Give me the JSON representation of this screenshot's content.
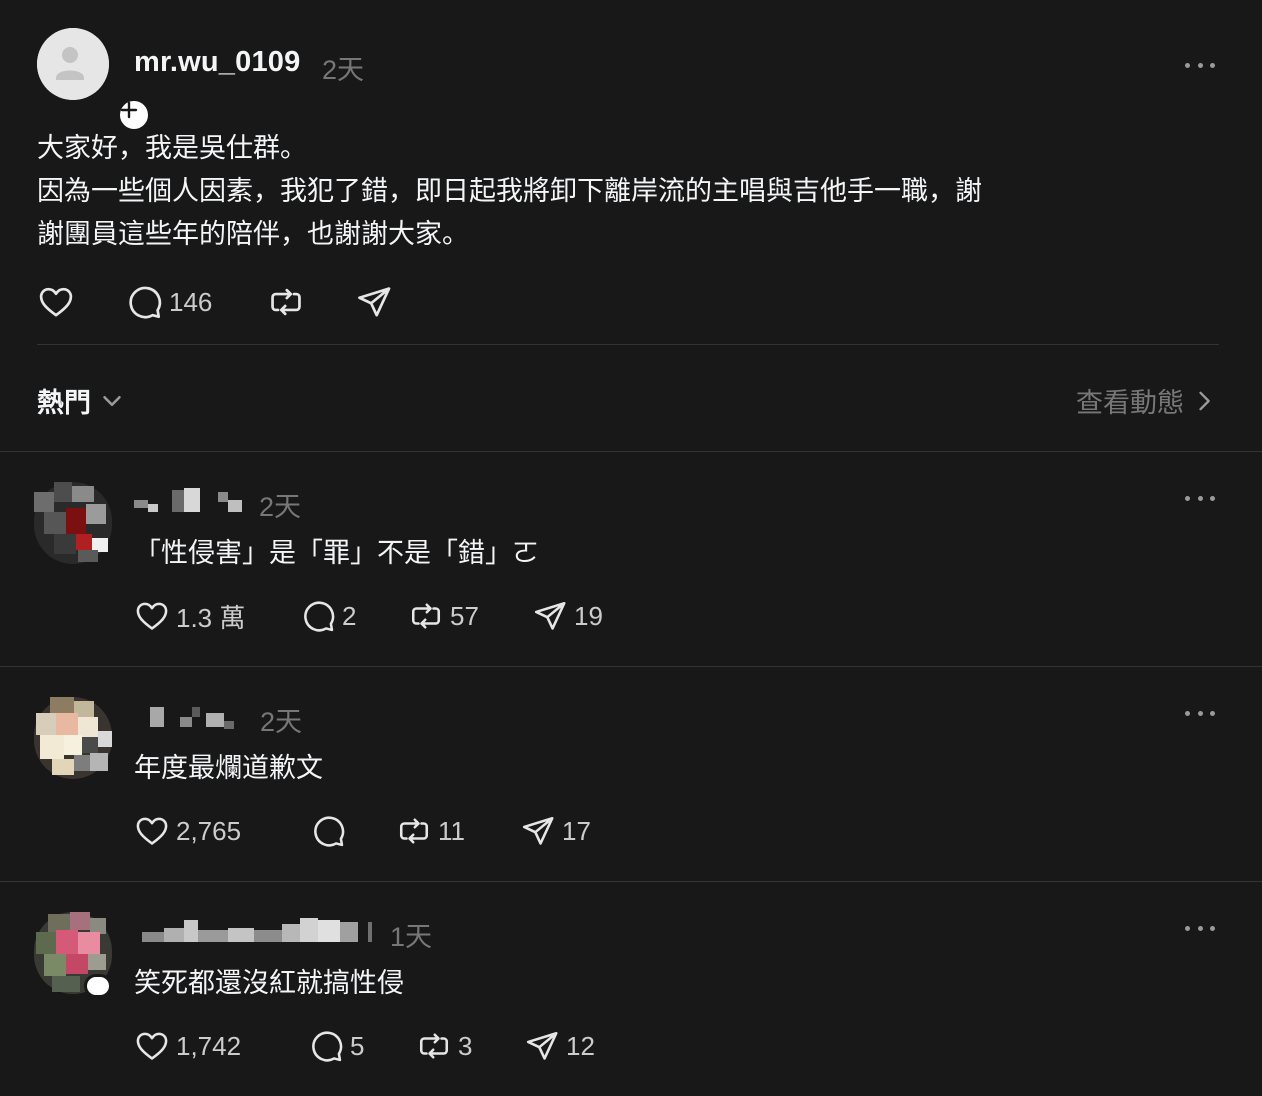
{
  "post": {
    "username": "mr.wu_0109",
    "time": "2天",
    "body_lines": [
      "大家好，我是吳仕群。",
      "因為一些個人因素，我犯了錯，即日起我將卸下離岸流的主唱與吉他手一職，謝",
      "謝團員這些年的陪伴，也謝謝大家。"
    ],
    "replies_count": "146",
    "icons": {
      "like": "heart-icon",
      "reply": "comment-icon",
      "repost": "repost-icon",
      "share": "send-icon",
      "more": "more-horizontal-icon",
      "follow": "plus-icon"
    }
  },
  "sort": {
    "label": "熱門",
    "view_activity": "查看動態"
  },
  "replies": [
    {
      "time": "2天",
      "text": "「性侵害」是「罪」不是「錯」ㄛ",
      "likes": "1.3 萬",
      "comments": "2",
      "reposts": "57",
      "shares": "19"
    },
    {
      "time": "2天",
      "text": "年度最爛道歉文",
      "likes": "2,765",
      "comments": "",
      "reposts": "11",
      "shares": "17"
    },
    {
      "time": "1天",
      "text": "笑死都還沒紅就搞性侵",
      "likes": "1,742",
      "comments": "5",
      "reposts": "3",
      "shares": "12"
    }
  ],
  "colors": {
    "background": "#181818",
    "text": "#f3f5f7",
    "muted": "#777777",
    "divider": "#333333"
  }
}
